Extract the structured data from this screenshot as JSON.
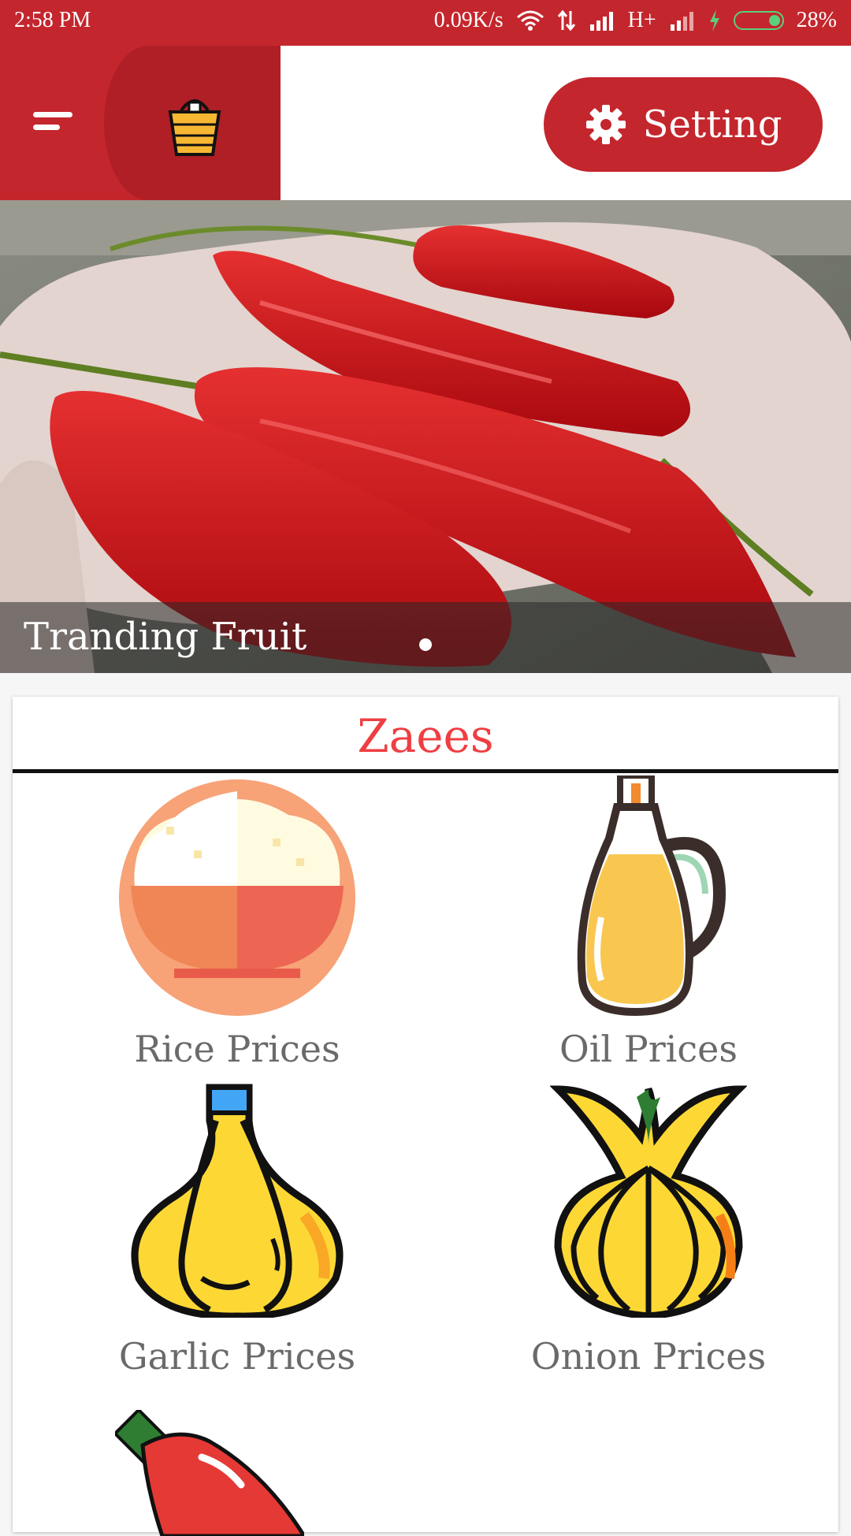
{
  "status_bar": {
    "time": "2:58 PM",
    "net_speed": "0.09K/s",
    "network_type": "H+",
    "battery": "28%"
  },
  "app_bar": {
    "setting_label": "Setting"
  },
  "banner": {
    "caption": "Tranding Fruit"
  },
  "card": {
    "title": "Zaees",
    "items": [
      {
        "label": "Rice Prices",
        "icon": "rice-bowl-icon"
      },
      {
        "label": "Oil Prices",
        "icon": "oil-bottle-icon"
      },
      {
        "label": "Garlic Prices",
        "icon": "garlic-icon"
      },
      {
        "label": "Onion Prices",
        "icon": "onion-icon"
      },
      {
        "label": "",
        "icon": "chili-pepper-icon"
      }
    ]
  },
  "colors": {
    "primary": "#c4262d",
    "title": "#ef3e42",
    "label": "#6a6a6a"
  }
}
